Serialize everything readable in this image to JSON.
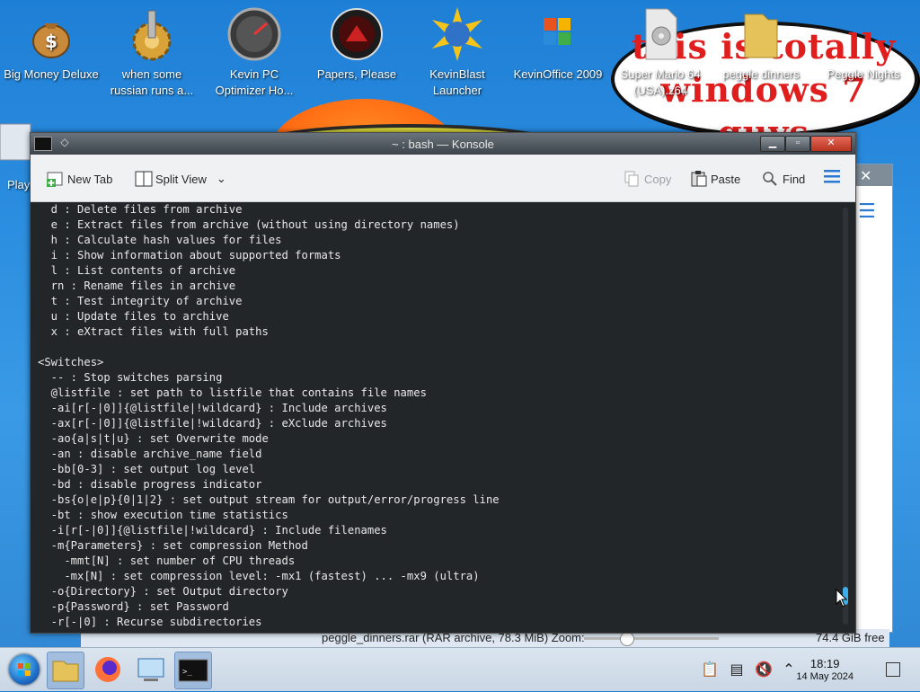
{
  "desktop": {
    "icons": [
      {
        "label": "Big Money Deluxe",
        "icon": "money-bag-icon"
      },
      {
        "label": "when some russian runs a...",
        "icon": "gear-icon"
      },
      {
        "label": "Kevin PC Optimizer Ho...",
        "icon": "speedometer-icon"
      },
      {
        "label": "Papers, Please",
        "icon": "emblem-icon"
      },
      {
        "label": "KevinBlast Launcher",
        "icon": "globe-burst-icon"
      },
      {
        "label": "KevinOffice 2009",
        "icon": "office-logo-icon"
      },
      {
        "label": "Super Mario 64 (USA).z64",
        "icon": "disc-file-icon"
      },
      {
        "label": "peggle dinners",
        "icon": "folder-icon"
      },
      {
        "label": "Peggle Nights",
        "icon": "game-icon"
      }
    ],
    "partial_left_label": "Play",
    "wallpaper_text": "this is totally windows 7 guys"
  },
  "konsole": {
    "title": "~ : bash — Konsole",
    "toolbar": {
      "new_tab": "New Tab",
      "split_view": "Split View",
      "copy": "Copy",
      "paste": "Paste",
      "find": "Find"
    },
    "terminal_lines": [
      "  d : Delete files from archive",
      "  e : Extract files from archive (without using directory names)",
      "  h : Calculate hash values for files",
      "  i : Show information about supported formats",
      "  l : List contents of archive",
      "  rn : Rename files in archive",
      "  t : Test integrity of archive",
      "  u : Update files to archive",
      "  x : eXtract files with full paths",
      "",
      "<Switches>",
      "  -- : Stop switches parsing",
      "  @listfile : set path to listfile that contains file names",
      "  -ai[r[-|0]]{@listfile|!wildcard} : Include archives",
      "  -ax[r[-|0]]{@listfile|!wildcard} : eXclude archives",
      "  -ao{a|s|t|u} : set Overwrite mode",
      "  -an : disable archive_name field",
      "  -bb[0-3] : set output log level",
      "  -bd : disable progress indicator",
      "  -bs{o|e|p}{0|1|2} : set output stream for output/error/progress line",
      "  -bt : show execution time statistics",
      "  -i[r[-|0]]{@listfile|!wildcard} : Include filenames",
      "  -m{Parameters} : set compression Method",
      "    -mmt[N] : set number of CPU threads",
      "    -mx[N] : set compression level: -mx1 (fastest) ... -mx9 (ultra)",
      "  -o{Directory} : set Output directory",
      "  -p{Password} : set Password",
      "  -r[-|0] : Recurse subdirectories"
    ]
  },
  "filemanager": {
    "status_file": "peggle_dinners.rar (RAR archive, 78.3 MiB)  Zoom:",
    "free_space": "74.4 GiB free"
  },
  "taskbar": {
    "time": "18:19",
    "date": "14 May 2024",
    "items": [
      "start-orb-icon",
      "file-manager-icon",
      "firefox-icon",
      "control-panel-icon",
      "terminal-icon"
    ]
  },
  "colors": {
    "accent": "#3daee9",
    "terminal_bg": "#232629",
    "wallpaper": "#2d8fe0"
  }
}
